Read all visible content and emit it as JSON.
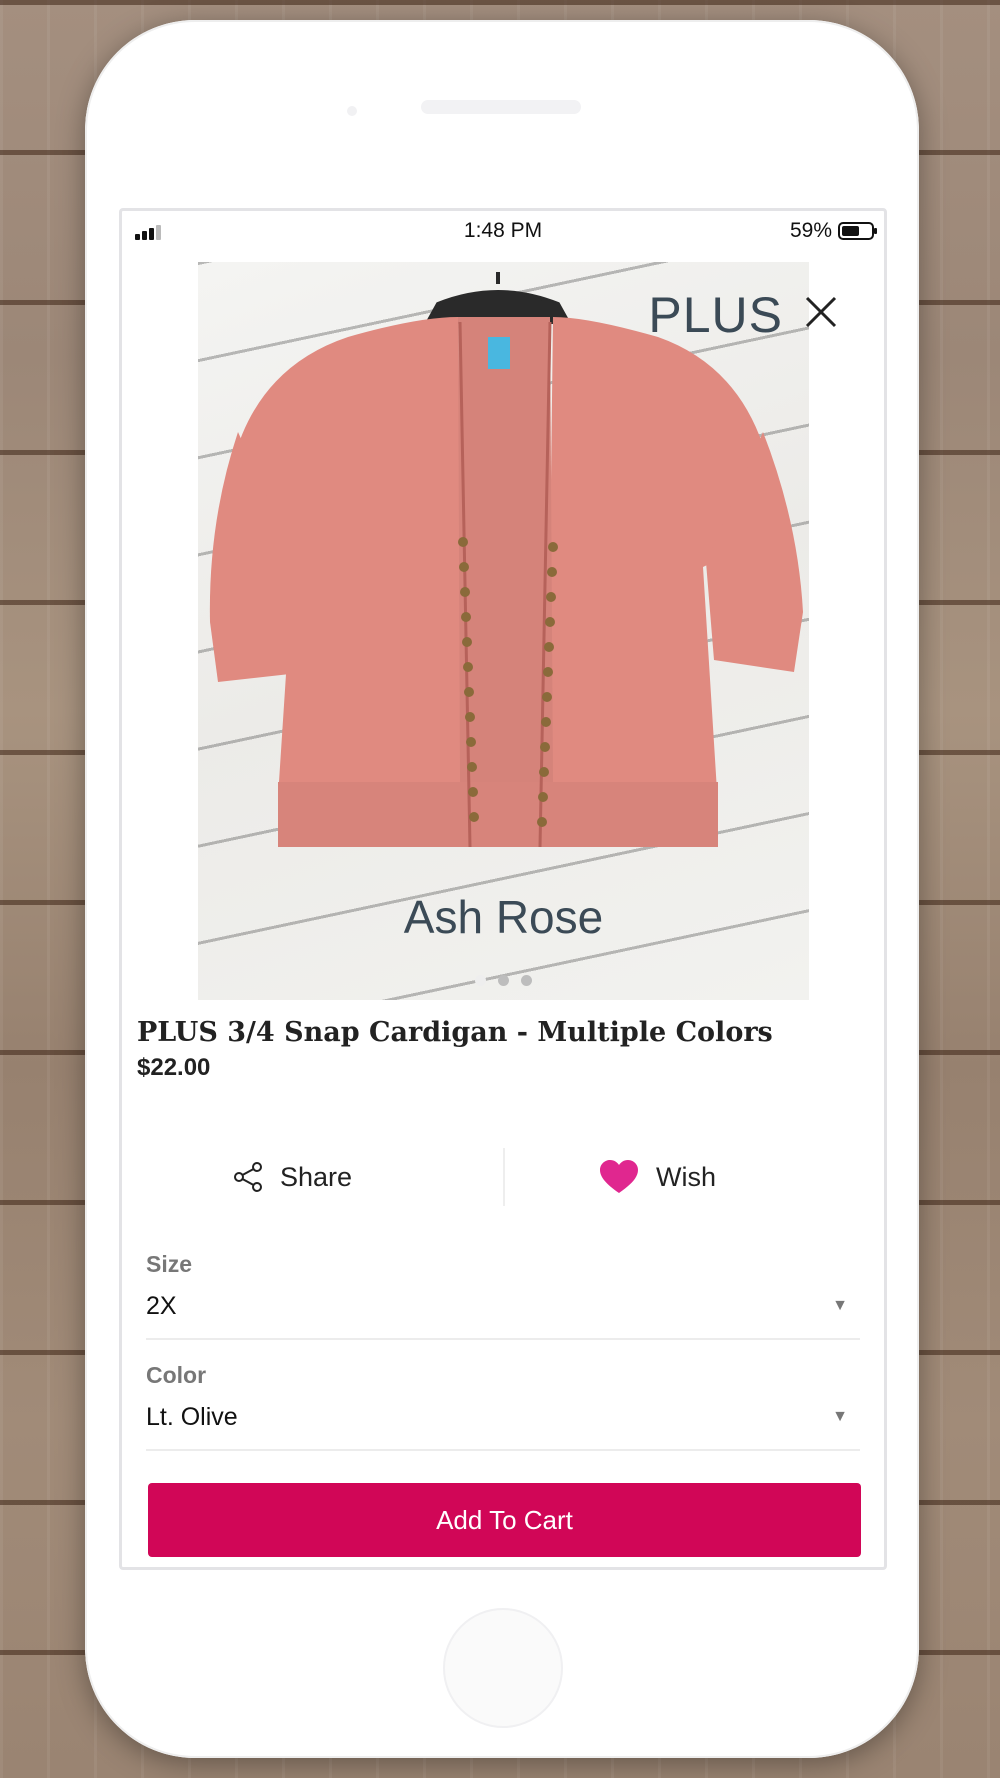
{
  "status_bar": {
    "time": "1:48 PM",
    "battery": "59%",
    "battery_level": 0.59
  },
  "product": {
    "image_overlay_text": "PLUS",
    "image_caption": "Ash Rose",
    "image_count": 3,
    "active_image_index": 0,
    "garment_color": "#e08a80",
    "title": "PLUS 3/4 Snap Cardigan - Multiple Colors",
    "price": "$22.00"
  },
  "actions": {
    "share_label": "Share",
    "wish_label": "Wish"
  },
  "options": {
    "size_label": "Size",
    "size_value": "2X",
    "color_label": "Color",
    "color_value": "Lt. Olive"
  },
  "cart": {
    "add_label": "Add To Cart"
  },
  "colors": {
    "accent": "#d10657",
    "wish_heart": "#e0278f",
    "label_gray": "#777777"
  }
}
